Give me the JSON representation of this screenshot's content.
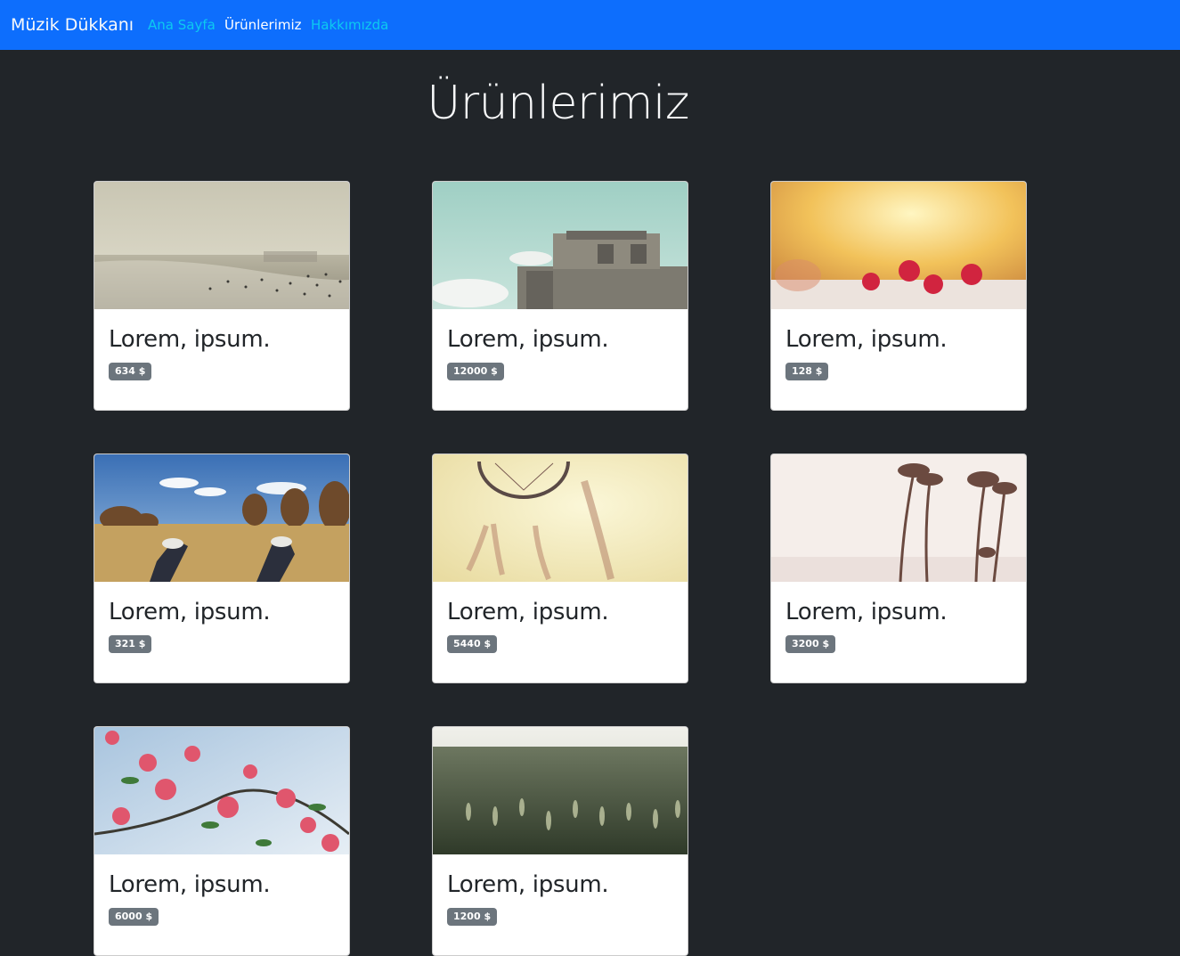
{
  "navbar": {
    "brand": "Müzik Dükkanı",
    "links": [
      {
        "label": "Ana Sayfa",
        "active": false
      },
      {
        "label": "Ürünlerimiz",
        "active": true
      },
      {
        "label": "Hakkımızda",
        "active": false
      }
    ],
    "background_color": "#0d6efd"
  },
  "page": {
    "title": "Ürünlerimiz",
    "background_color": "#212529"
  },
  "products": [
    {
      "image": "beach-scene",
      "title": "Lorem, ipsum.",
      "price": "634 $"
    },
    {
      "image": "concrete-building",
      "title": "Lorem, ipsum.",
      "price": "12000 $"
    },
    {
      "image": "raspberries",
      "title": "Lorem, ipsum.",
      "price": "128 $"
    },
    {
      "image": "sneakers-on-grass",
      "title": "Lorem, ipsum.",
      "price": "321 $"
    },
    {
      "image": "dreamcatcher",
      "title": "Lorem, ipsum.",
      "price": "5440 $"
    },
    {
      "image": "palm-trees",
      "title": "Lorem, ipsum.",
      "price": "3200 $"
    },
    {
      "image": "pink-blossoms",
      "title": "Lorem, ipsum.",
      "price": "6000 $"
    },
    {
      "image": "wheat-field",
      "title": "Lorem, ipsum.",
      "price": "1200 $"
    }
  ]
}
